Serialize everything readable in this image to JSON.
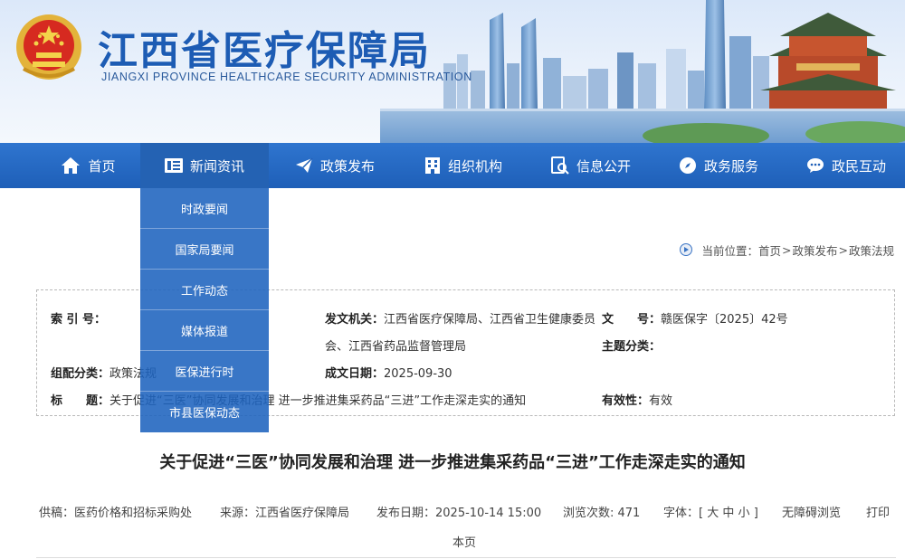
{
  "header": {
    "title": "江西省医疗保障局",
    "subtitle": "JIANGXI PROVINCE HEALTHCARE SECURITY ADMINISTRATION"
  },
  "nav": {
    "items": [
      {
        "label": "首页",
        "icon": "home-icon"
      },
      {
        "label": "新闻资讯",
        "icon": "news-icon"
      },
      {
        "label": "政策发布",
        "icon": "paper-plane-icon"
      },
      {
        "label": "组织机构",
        "icon": "building-icon"
      },
      {
        "label": "信息公开",
        "icon": "search-doc-icon"
      },
      {
        "label": "政务服务",
        "icon": "compass-icon"
      },
      {
        "label": "政民互动",
        "icon": "chat-icon"
      }
    ],
    "active_index": 1,
    "dropdown": [
      "时政要闻",
      "国家局要闻",
      "工作动态",
      "媒体报道",
      "医保进行时",
      "市县医保动态"
    ]
  },
  "breadcrumb": {
    "prefix": "当前位置：",
    "items": [
      "首页",
      "政策发布",
      "政策法规"
    ],
    "separator": ">"
  },
  "info": {
    "index_no_label": "索 引 号：",
    "index_no_value": "",
    "issuer_label": "发文机关：",
    "issuer_value": "江西省医疗保障局、江西省卫生健康委员会、江西省药品监督管理局",
    "doc_no_label": "文　　号：",
    "doc_no_value": "赣医保字〔2025〕42号",
    "topic_label": "主题分类：",
    "topic_value": "",
    "category_label": "组配分类：",
    "category_value": "政策法规",
    "date_label": "成文日期：",
    "date_value": "2025-09-30",
    "title_label": "标　　题：",
    "title_value": "关于促进“三医”协同发展和治理 进一步推进集采药品“三进”工作走深走实的通知",
    "validity_label": "有效性：",
    "validity_value": "有效"
  },
  "article": {
    "title": "关于促进“三医”协同发展和治理 进一步推进集采药品“三进”工作走深走实的通知",
    "supplier": "供稿：医药价格和招标采购处",
    "source": "来源：江西省医疗保障局",
    "publish": "发布日期：2025-10-14 15:00",
    "views": "浏览次数: 471",
    "font_label": "字体：",
    "font_large": "大",
    "font_medium": "中",
    "font_small": "小",
    "accessible": "无障碍浏览",
    "print_a": "打印",
    "print_b": "本页"
  },
  "colors": {
    "nav_bg": "#1e5fb8",
    "title_blue": "#1d5cb4",
    "dropdown_bg": "#1e63be"
  }
}
